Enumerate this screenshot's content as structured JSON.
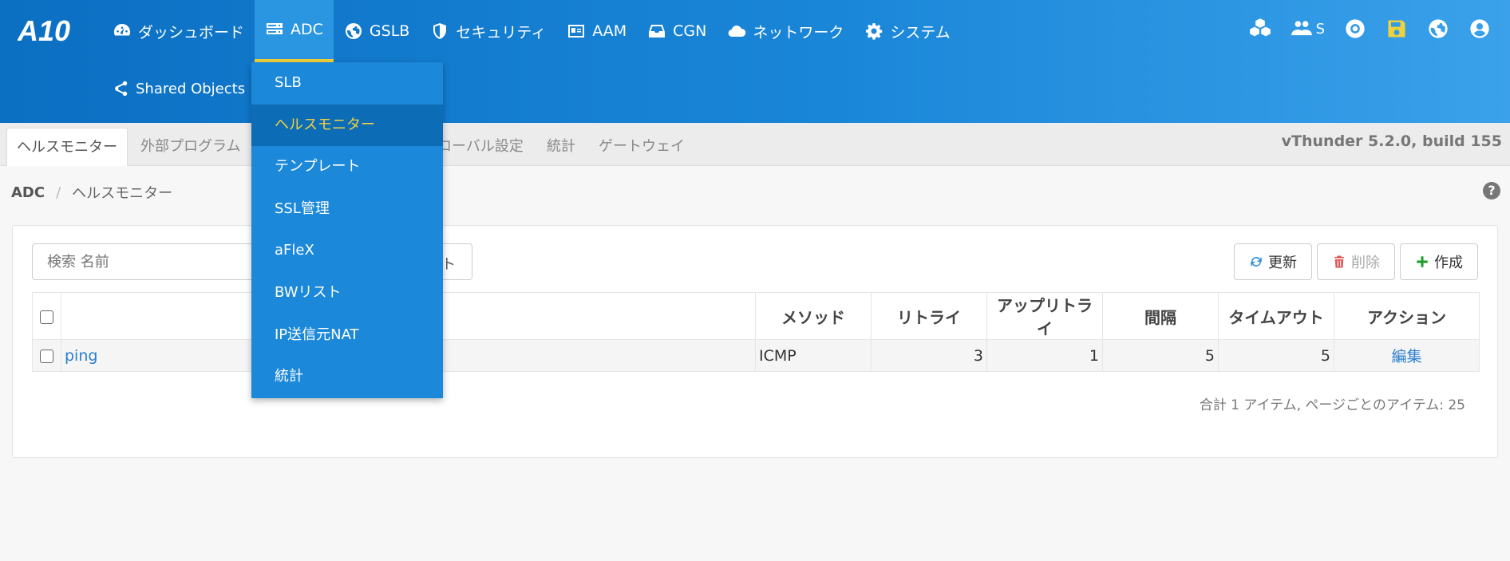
{
  "brand": {
    "logo_text": "A10"
  },
  "nav": {
    "items": [
      {
        "label": "ダッシュボード",
        "icon": "dashboard-icon"
      },
      {
        "label": "ADC",
        "icon": "server-icon",
        "active": true
      },
      {
        "label": "GSLB",
        "icon": "globe-icon"
      },
      {
        "label": "セキュリティ",
        "icon": "shield-icon"
      },
      {
        "label": "AAM",
        "icon": "id-card-icon"
      },
      {
        "label": "CGN",
        "icon": "inbox-icon"
      },
      {
        "label": "ネットワーク",
        "icon": "cloud-icon"
      },
      {
        "label": "システム",
        "icon": "gear-icon"
      }
    ],
    "shared_objects": "Shared Objects",
    "user_label": "S"
  },
  "dropdown": {
    "items": [
      "SLB",
      "ヘルスモニター",
      "テンプレート",
      "SSL管理",
      "aFleX",
      "BWリスト",
      "IP送信元NAT",
      "統計"
    ],
    "active_index": 1
  },
  "tabs": {
    "items": [
      "ヘルスモニター",
      "外部プログラム",
      "ローバル設定",
      "統計",
      "ゲートウェイ"
    ],
    "version": "vThunder 5.2.0, build 155"
  },
  "breadcrumb": {
    "root": "ADC",
    "sep": "/",
    "current": "ヘルスモニター"
  },
  "search": {
    "placeholder": "検索 名前",
    "button_partial": "ト"
  },
  "toolbar": {
    "refresh": "更新",
    "delete": "削除",
    "create": "作成"
  },
  "table": {
    "headers": [
      "メソッド",
      "リトライ",
      "アップリトライ",
      "間隔",
      "タイムアウト",
      "アクション"
    ],
    "rows": [
      {
        "name": "ping",
        "method": "ICMP",
        "retry": "3",
        "up_retry": "1",
        "interval": "5",
        "timeout": "5",
        "action": "編集"
      }
    ]
  },
  "footer": {
    "info": "合計 1 アイテム,  ページごとのアイテム: 25"
  },
  "colors": {
    "header_start": "#0b6fc2",
    "header_end": "#3aa1ea",
    "accent_yellow": "#f2d23c",
    "dropdown_bg": "#1b88d9",
    "link": "#2a7fd0"
  }
}
